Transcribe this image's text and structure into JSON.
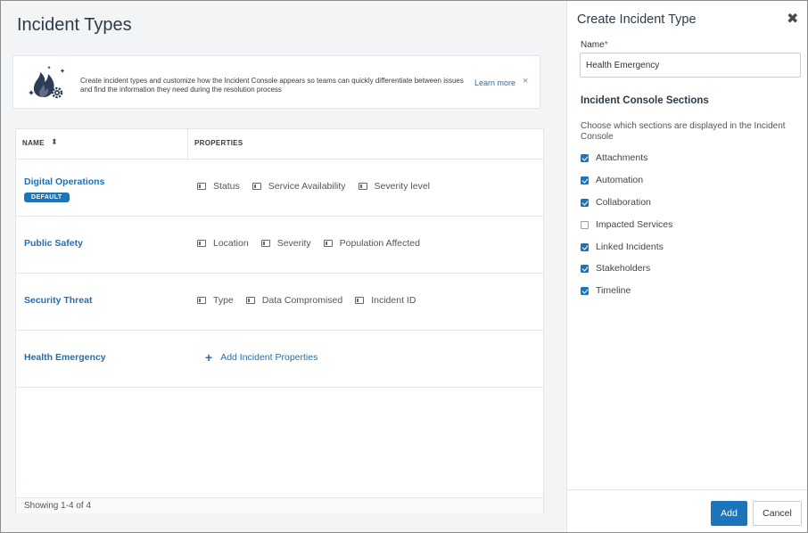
{
  "page": {
    "title": "Incident Types"
  },
  "banner": {
    "illustration_icon": "fire-gear-icon",
    "text": "Create incident types and customize how the Incident Console appears so teams can quickly differentiate between issues and find the information they need during the resolution process",
    "learn_more": "Learn more",
    "close_glyph": "×"
  },
  "table": {
    "columns": {
      "name": "NAME",
      "sort_glyph": "⬍",
      "properties": "PROPERTIES"
    },
    "rows": [
      {
        "name": "Digital Operations",
        "badge": "DEFAULT",
        "properties": [
          "Status",
          "Service Availability",
          "Severity level"
        ]
      },
      {
        "name": "Public Safety",
        "properties": [
          "Location",
          "Severity",
          "Population Affected"
        ]
      },
      {
        "name": "Security Threat",
        "properties": [
          "Type",
          "Data Compromised",
          "Incident ID"
        ]
      },
      {
        "name": "Health Emergency",
        "add_properties": "Add Incident Properties"
      }
    ],
    "footer": "Showing 1-4 of 4"
  },
  "panel": {
    "title": "Create Incident Type",
    "close_glyph": "✖",
    "name_label": "Name",
    "required_mark": "*",
    "name_value": "Health Emergency",
    "sections_title": "Incident Console Sections",
    "sections_desc": "Choose which sections are displayed in the Incident Console",
    "sections": [
      {
        "label": "Attachments",
        "checked": true
      },
      {
        "label": "Automation",
        "checked": true
      },
      {
        "label": "Collaboration",
        "checked": true
      },
      {
        "label": "Impacted Services",
        "checked": false
      },
      {
        "label": "Linked Incidents",
        "checked": true
      },
      {
        "label": "Stakeholders",
        "checked": true
      },
      {
        "label": "Timeline",
        "checked": true
      }
    ],
    "add_label": "Add",
    "cancel_label": "Cancel"
  },
  "colors": {
    "primary": "#1b75bb",
    "link": "#1f6fb2",
    "required": "#c9302c"
  }
}
